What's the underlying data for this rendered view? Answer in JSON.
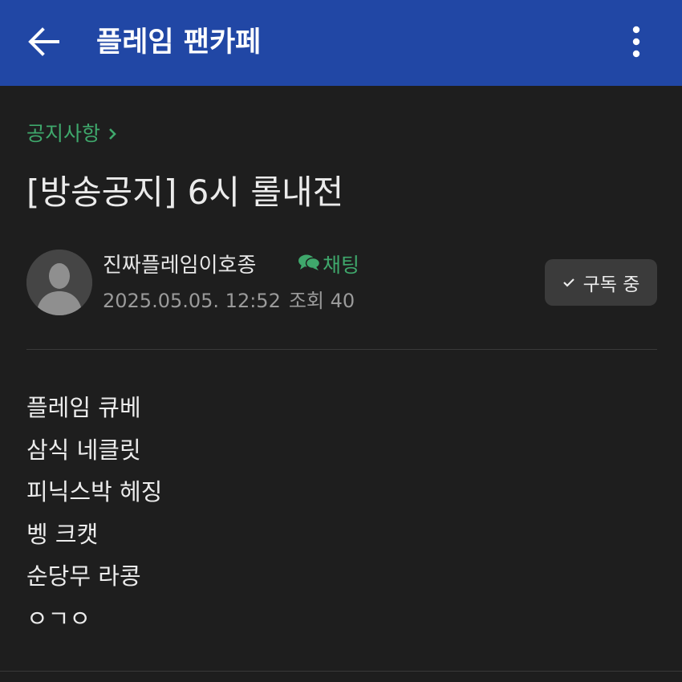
{
  "header": {
    "back_icon": "arrow-left-icon",
    "title": "플레임 팬카페",
    "more_icon": "more-vertical-icon"
  },
  "breadcrumb": {
    "label": "공지사항",
    "icon": "chevron-right-icon"
  },
  "post": {
    "title": "[방송공지] 6시 롤내전",
    "author": {
      "avatar_icon": "default-avatar-icon",
      "name": "진짜플레임이호종",
      "chat_label": "채팅",
      "chat_icon": "chat-bubbles-icon"
    },
    "meta": {
      "date": "2025.05.05. 12:52",
      "views": "조회 40"
    },
    "subscribe": {
      "label": "구독 중",
      "icon": "check-icon"
    },
    "body_lines": [
      "플레임 큐베",
      "삼식 네클릿",
      "피닉스박 헤징",
      "벵 크캣",
      "순당무 라콩",
      "ㅇㄱㅇ"
    ]
  },
  "colors": {
    "header_bg": "#2147a5",
    "page_bg": "#1e1e1e",
    "accent_green": "#3fa86c",
    "subscribe_bg": "#3b3b3b"
  }
}
